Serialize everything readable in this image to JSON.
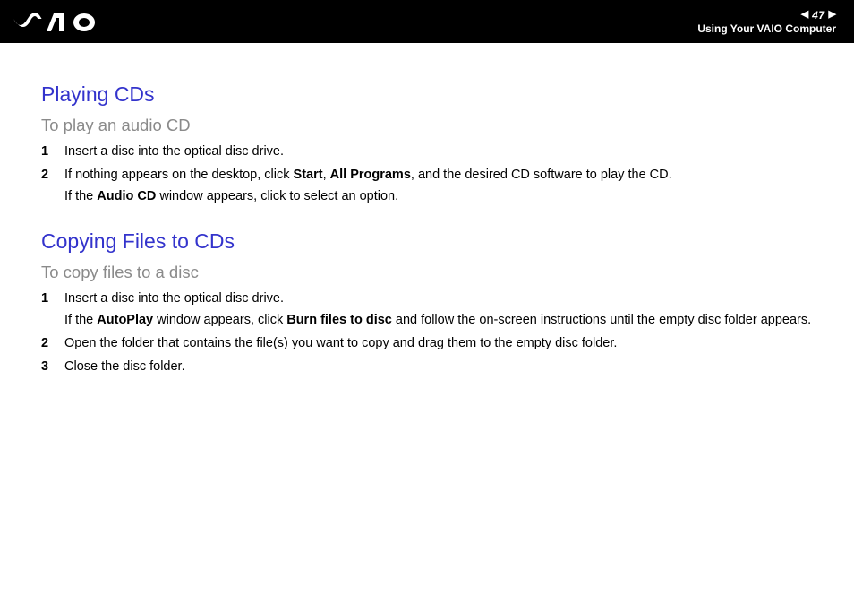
{
  "header": {
    "page_number": "47",
    "subtitle": "Using Your VAIO Computer"
  },
  "sections": [
    {
      "heading": "Playing CDs",
      "subheading": "To play an audio CD",
      "steps": [
        {
          "num": "1",
          "lines": [
            "Insert a disc into the optical disc drive."
          ]
        },
        {
          "num": "2",
          "lines": [
            "If nothing appears on the desktop, click <b>Start</b>, <b>All Programs</b>, and the desired CD software to play the CD.",
            "If the <b>Audio CD</b> window appears, click to select an option."
          ]
        }
      ]
    },
    {
      "heading": "Copying Files to CDs",
      "subheading": "To copy files to a disc",
      "steps": [
        {
          "num": "1",
          "lines": [
            "Insert a disc into the optical disc drive.",
            "If the <b>AutoPlay</b> window appears, click <b>Burn files to disc</b> and follow the on-screen instructions until the empty disc folder appears."
          ]
        },
        {
          "num": "2",
          "lines": [
            "Open the folder that contains the file(s) you want to copy and drag them to the empty disc folder."
          ]
        },
        {
          "num": "3",
          "lines": [
            "Close the disc folder."
          ]
        }
      ]
    }
  ]
}
